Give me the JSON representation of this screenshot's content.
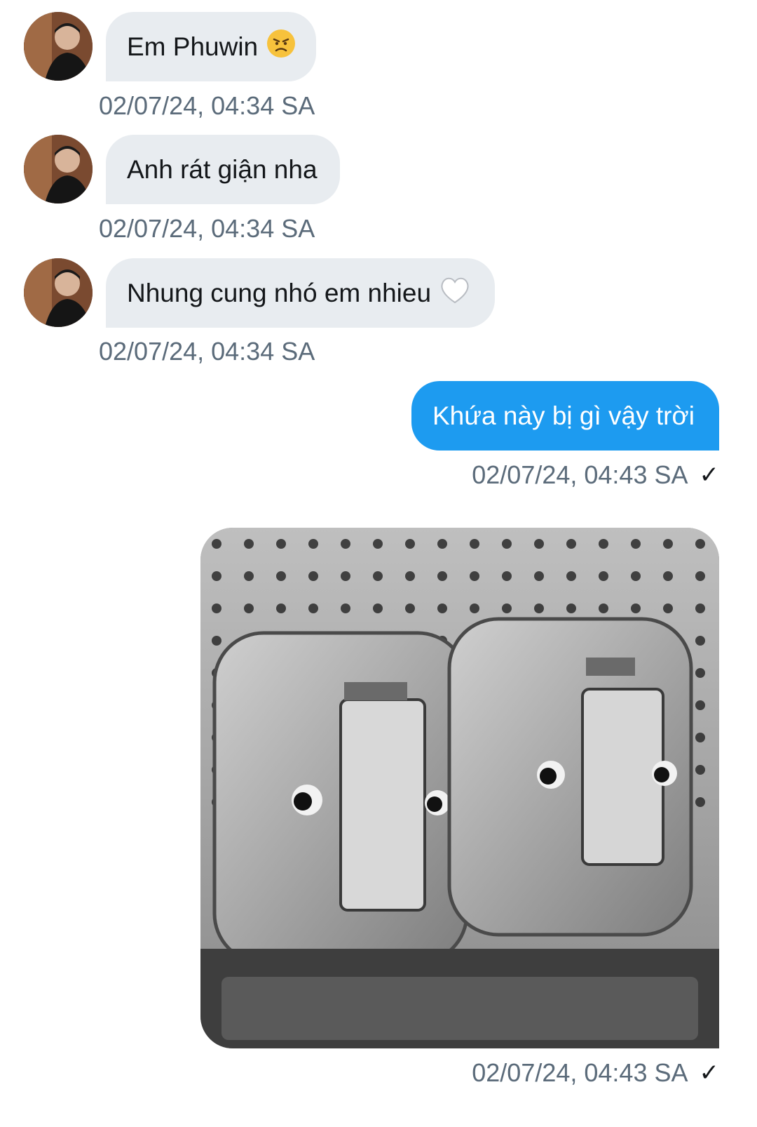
{
  "messages": [
    {
      "text": "Em Phuwin",
      "emoji": "angry-face",
      "timestamp": "02/07/24, 04:34 SA"
    },
    {
      "text": "Anh rát giận nha",
      "timestamp": "02/07/24, 04:34 SA"
    },
    {
      "text": "Nhung cung nhó em nhieu",
      "emoji": "white-heart",
      "timestamp": "02/07/24, 04:34 SA"
    },
    {
      "text": "Khứa này bị gì vậy trời",
      "timestamp": "02/07/24, 04:43 SA",
      "status": "✓"
    },
    {
      "image": "light-switches-with-eyes-photo",
      "timestamp": "02/07/24, 04:43 SA",
      "status": "✓"
    }
  ],
  "colors": {
    "incoming_bubble": "#e8ecf0",
    "outgoing_bubble": "#1d9bf0",
    "timestamp": "#5b6b7a"
  }
}
